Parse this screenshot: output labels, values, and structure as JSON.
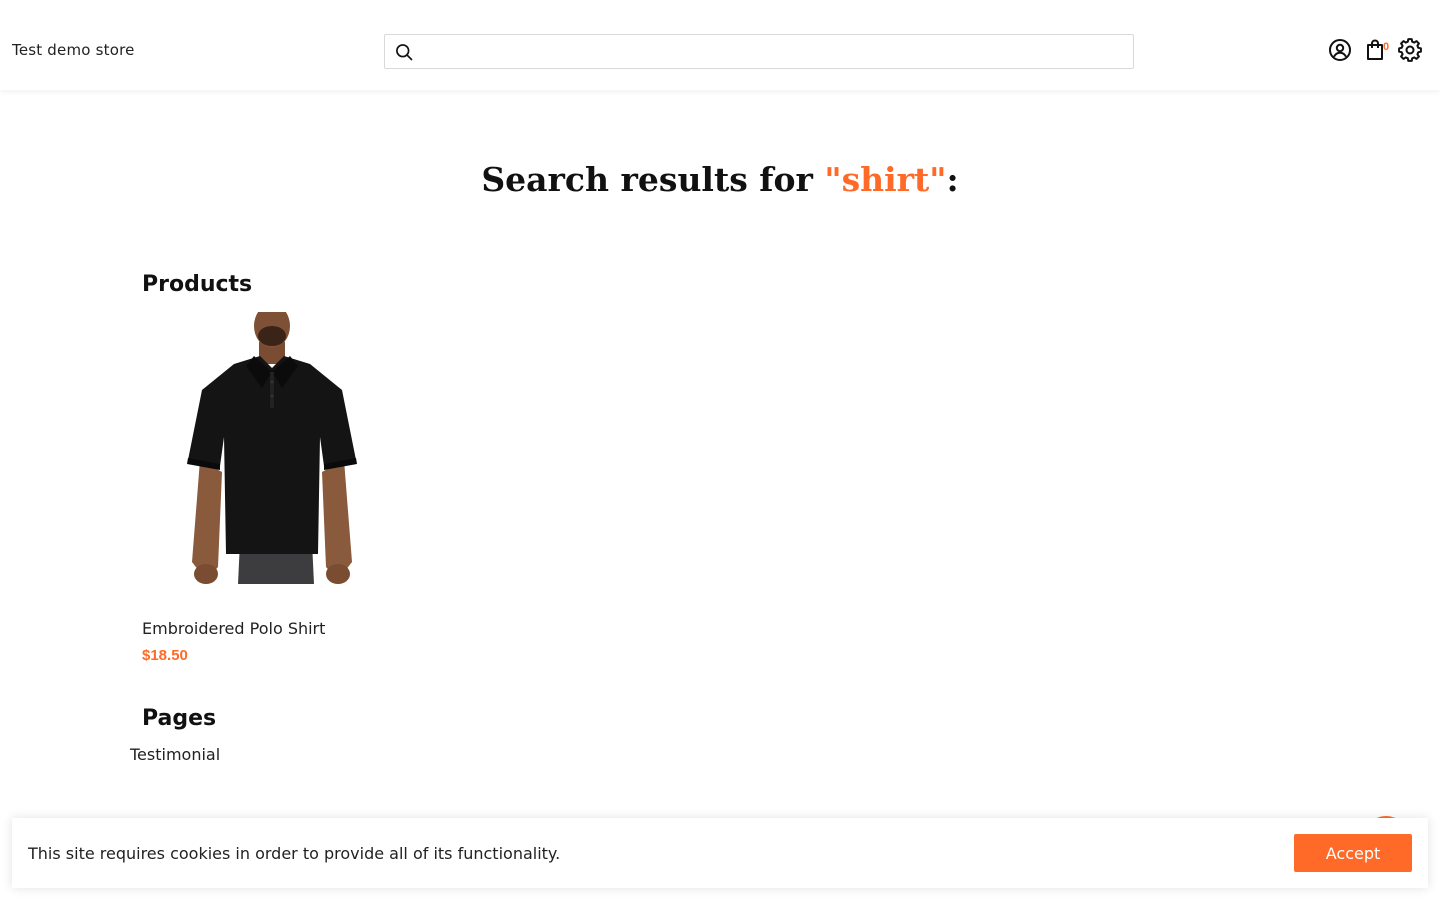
{
  "header": {
    "store_name": "Test demo store",
    "search": {
      "value": "",
      "placeholder": ""
    },
    "cart_count": "0",
    "icons": [
      "search-icon",
      "account-icon",
      "cart-icon",
      "settings-icon"
    ]
  },
  "title": {
    "prefix": "Search results for ",
    "query": "\"shirt\"",
    "suffix": ":"
  },
  "products": {
    "heading": "Products",
    "items": [
      {
        "name": "Embroidered Polo Shirt",
        "price": "$18.50"
      }
    ]
  },
  "pages": {
    "heading": "Pages",
    "items": [
      {
        "label": "Testimonial"
      }
    ]
  },
  "cookie_banner": {
    "message": "This site requires cookies in order to provide all of its functionality.",
    "accept_label": "Accept"
  },
  "colors": {
    "accent": "#ff6a28",
    "text": "#111111",
    "background": "#ffffff"
  }
}
